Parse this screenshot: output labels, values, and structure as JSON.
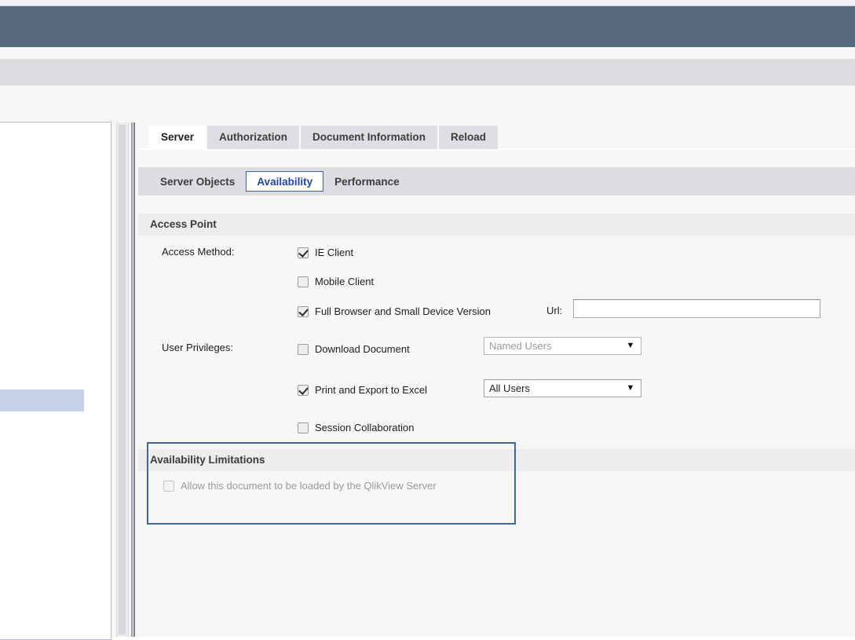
{
  "window": {
    "header_color": "#596a7f",
    "toolbar_band_color": "#dddde1",
    "content_bg": "#f7f7f8"
  },
  "left_panel": {
    "name": "document-list",
    "selected_row_color": "#c5d2ea",
    "scrollbar": "vertical-scrollbar"
  },
  "main_tabs": [
    {
      "label": "Server",
      "active": true
    },
    {
      "label": "Authorization",
      "active": false
    },
    {
      "label": "Document Information",
      "active": false
    },
    {
      "label": "Reload",
      "active": false
    }
  ],
  "sub_tabs": [
    {
      "label": "Server Objects",
      "active": false
    },
    {
      "label": "Availability",
      "active": true
    },
    {
      "label": "Performance",
      "active": false
    }
  ],
  "access_point": {
    "section_title": "Access Point",
    "access_method_label": "Access Method:",
    "access_methods": [
      {
        "label": "IE Client",
        "checked": true,
        "disabled": false
      },
      {
        "label": "Mobile Client",
        "checked": false,
        "disabled": false
      },
      {
        "label": "Full Browser and Small Device Version",
        "checked": true,
        "disabled": false
      }
    ],
    "url_label": "Url:",
    "url_value": "",
    "url_placeholder": "",
    "user_privileges_label": "User Privileges:",
    "user_privileges": [
      {
        "label": "Download Document",
        "checked": false,
        "disabled": false
      },
      {
        "label": "Print and Export to Excel",
        "checked": true,
        "disabled": false
      },
      {
        "label": "Session Collaboration",
        "checked": false,
        "disabled": false
      }
    ],
    "download_document_select": {
      "value": "Named Users",
      "disabled": true,
      "options": [
        "Named Users",
        "All Users"
      ],
      "arrow_icon": "chevron-down-icon"
    },
    "print_export_select": {
      "value": "All Users",
      "disabled": false,
      "options": [
        "Named Users",
        "All Users"
      ],
      "arrow_icon": "chevron-down-icon"
    }
  },
  "availability_limitations": {
    "section_title": "Availability Limitations",
    "highlight_color": "#3f6895",
    "allow_load": {
      "label": "Allow this document to be loaded by the QlikView Server",
      "checked": false,
      "disabled": true
    }
  },
  "icons": {
    "chevron_down": "▼"
  }
}
